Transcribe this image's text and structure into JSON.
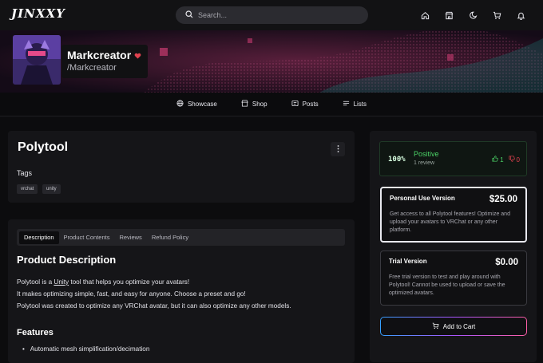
{
  "header": {
    "logo": "JINXXY",
    "search_placeholder": "Search..."
  },
  "creator": {
    "name": "Markcreator",
    "handle": "/Markcreator"
  },
  "nav": [
    {
      "label": "Showcase",
      "icon": "globe-icon"
    },
    {
      "label": "Shop",
      "icon": "store-icon"
    },
    {
      "label": "Posts",
      "icon": "posts-icon"
    },
    {
      "label": "Lists",
      "icon": "list-icon"
    }
  ],
  "product": {
    "title": "Polytool",
    "tags_label": "Tags",
    "tags": [
      "vrchat",
      "unity"
    ]
  },
  "tabs": [
    "Description",
    "Product Contents",
    "Reviews",
    "Refund Policy"
  ],
  "description": {
    "heading": "Product Description",
    "line1_pre": "Polytool is a ",
    "line1_link": "Unity",
    "line1_post": " tool that helps you optimize your avatars!",
    "line2": "It makes optimizing simple, fast, and easy for anyone. Choose a preset and go!",
    "line3": "Polytool was created to optimize any VRChat avatar, but it can also optimize any other models.",
    "features_heading": "Features",
    "feature1": "Automatic mesh simplification/decimation"
  },
  "rating": {
    "percent": "100%",
    "label": "Positive",
    "reviews": "1 review",
    "up": "1",
    "down": "0"
  },
  "options": [
    {
      "name": "Personal Use Version",
      "price": "$25.00",
      "desc": "Get access to all Polytool features! Optimize and upload your avatars to VRChat or any other platform."
    },
    {
      "name": "Trial Version",
      "price": "$0.00",
      "desc": "Free trial version to test and play around with Polytool! Cannot be used to upload or save the optimized avatars."
    }
  ],
  "cart_label": "Add to Cart",
  "colors": {
    "positive": "#4bd266",
    "accent_gradient_start": "#36a1ff",
    "accent_gradient_end": "#ff5fa8",
    "heart": "#e0424f"
  }
}
